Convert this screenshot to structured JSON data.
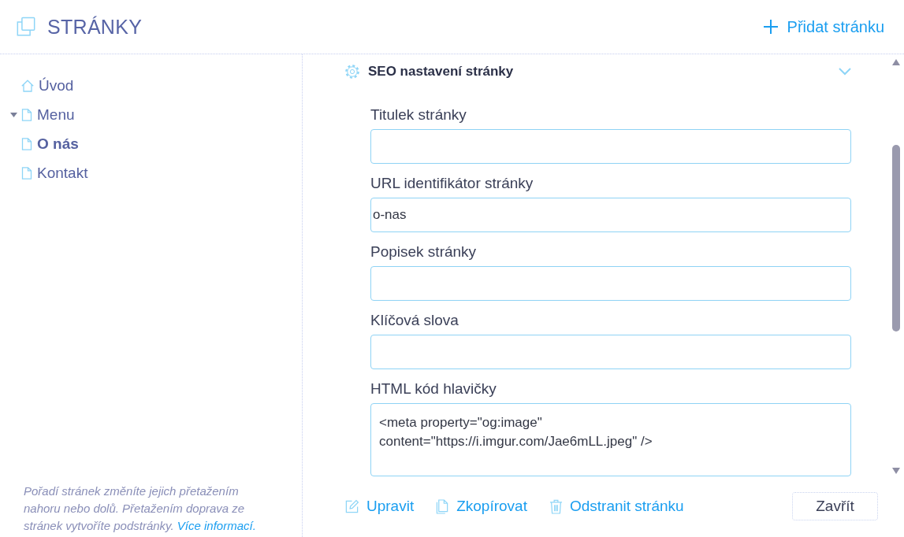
{
  "header": {
    "title": "STRÁNKY",
    "add_button": "Přidat stránku"
  },
  "sidebar": {
    "items": [
      {
        "label": "Úvod",
        "kind": "home",
        "selected": false
      },
      {
        "label": "Menu",
        "kind": "page",
        "expanded": true,
        "selected": false
      },
      {
        "label": "O nás",
        "kind": "page",
        "selected": true
      },
      {
        "label": "Kontakt",
        "kind": "page",
        "selected": false
      }
    ],
    "help": {
      "text": "Pořadí stránek změníte jejich přetažením nahoru nebo dolů. Přetažením doprava ze stránek vytvoříte podstránky.",
      "link": "Více informací."
    }
  },
  "seo_section": {
    "title": "SEO nastavení stránky",
    "expanded": true,
    "fields": [
      {
        "label": "Titulek stránky",
        "kind": "input"
      },
      {
        "label": "URL identifikátor stránky",
        "kind": "input",
        "value": "o-nas"
      },
      {
        "label": "Popisek stránky",
        "kind": "input"
      },
      {
        "label": "Klíčová slova",
        "kind": "input"
      },
      {
        "label": "HTML kód hlavičky",
        "kind": "textarea",
        "value": "<meta property=\"og:image\"\ncontent=\"https://i.imgur.com/Jae6mLL.jpeg\" />"
      }
    ]
  },
  "actions": [
    {
      "label": "Upravit",
      "kind": "edit"
    },
    {
      "label": "Zkopírovat",
      "kind": "copy"
    },
    {
      "label": "Odstranit stránku",
      "kind": "delete"
    }
  ],
  "close_button": "Zavřít"
}
